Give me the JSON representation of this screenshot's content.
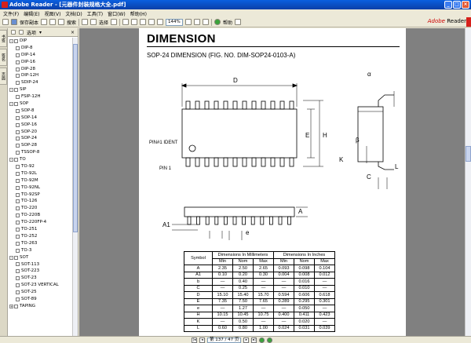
{
  "window": {
    "title": "Adobe Reader - [元器件封装规格大全.pdf]",
    "controls": [
      "_",
      "□",
      "×"
    ]
  },
  "menu": [
    "文件(F)",
    "编辑(E)",
    "视图(V)",
    "文档(D)",
    "工具(T)",
    "窗口(W)",
    "帮助(H)"
  ],
  "toolbar": {
    "save_copy": "保存副本",
    "search": "搜索",
    "select": "选择",
    "zoom": "144%",
    "help": "帮助",
    "brand_adobe": "Adobe",
    "brand_reader": "Reader"
  },
  "navtabs": [
    "书签",
    "签名",
    "页面"
  ],
  "panel": {
    "options": "选项",
    "bookmarks": [
      {
        "level": 0,
        "toggle": "-",
        "label": "DIP"
      },
      {
        "level": 1,
        "label": "DIP-8"
      },
      {
        "level": 1,
        "label": "DIP-14"
      },
      {
        "level": 1,
        "label": "DIP-16"
      },
      {
        "level": 1,
        "label": "DIP-28"
      },
      {
        "level": 1,
        "label": "DIP-12H"
      },
      {
        "level": 1,
        "label": "SDIP-24"
      },
      {
        "level": 0,
        "toggle": "-",
        "label": "SIP"
      },
      {
        "level": 1,
        "label": "FSIP-12H"
      },
      {
        "level": 0,
        "toggle": "-",
        "label": "SOP"
      },
      {
        "level": 1,
        "label": "SOP-8"
      },
      {
        "level": 1,
        "label": "SOP-14"
      },
      {
        "level": 1,
        "label": "SOP-16"
      },
      {
        "level": 1,
        "label": "SOP-20"
      },
      {
        "level": 1,
        "label": "SOP-24"
      },
      {
        "level": 1,
        "label": "SOP-28"
      },
      {
        "level": 1,
        "label": "TSSOP-8"
      },
      {
        "level": 0,
        "toggle": "-",
        "label": "TO"
      },
      {
        "level": 1,
        "label": "TO-92"
      },
      {
        "level": 1,
        "label": "TO-92L"
      },
      {
        "level": 1,
        "label": "TO-92M"
      },
      {
        "level": 1,
        "label": "TO-92NL"
      },
      {
        "level": 1,
        "label": "TO-92SP"
      },
      {
        "level": 1,
        "label": "TO-126"
      },
      {
        "level": 1,
        "label": "TO-220"
      },
      {
        "level": 1,
        "label": "TO-220B"
      },
      {
        "level": 1,
        "label": "TO-220FP-4"
      },
      {
        "level": 1,
        "label": "TO-251"
      },
      {
        "level": 1,
        "label": "TO-252"
      },
      {
        "level": 1,
        "label": "TO-263"
      },
      {
        "level": 1,
        "label": "TO-3"
      },
      {
        "level": 0,
        "toggle": "-",
        "label": "SOT"
      },
      {
        "level": 1,
        "label": "SOT-113"
      },
      {
        "level": 1,
        "label": "SOT-223"
      },
      {
        "level": 1,
        "label": "SOT-23"
      },
      {
        "level": 1,
        "label": "SOT-23 VERTICAL"
      },
      {
        "level": 1,
        "label": "SOT-25"
      },
      {
        "level": 1,
        "label": "SOT-89"
      },
      {
        "level": 0,
        "toggle": "+",
        "label": "TAPING"
      }
    ]
  },
  "document": {
    "heading": "DIMENSION",
    "subtitle": "SOP-24 DIMENSION (FIG. NO. DIM-SOP24-0103-A)",
    "labels": {
      "D": "D",
      "E": "E",
      "H": "H",
      "A": "A",
      "A1": "A1",
      "e": "e",
      "L": "L",
      "K": "K",
      "C": "C",
      "alpha": "α",
      "beta": "β",
      "pin1_ident": "PIN#1 IDENT",
      "pin1": "PIN 1"
    },
    "table": {
      "symbol_header": "Symbol",
      "mm_header": "Dimensions In Millimeters",
      "in_header": "Dimensions In Inches",
      "sub_headers": [
        "Min",
        "Nom",
        "Max",
        "Min",
        "Nom",
        "Max"
      ],
      "rows": [
        [
          "A",
          "2.35",
          "2.50",
          "2.65",
          "0.093",
          "0.098",
          "0.104"
        ],
        [
          "A1",
          "0.10",
          "0.20",
          "0.30",
          "0.004",
          "0.008",
          "0.012"
        ],
        [
          "b",
          "—",
          "0.40",
          "—",
          "—",
          "0.016",
          "—"
        ],
        [
          "C",
          "—",
          "0.25",
          "—",
          "—",
          "0.010",
          "—"
        ],
        [
          "D",
          "15.10",
          "15.40",
          "15.70",
          "0.594",
          "0.606",
          "0.618"
        ],
        [
          "E",
          "7.35",
          "7.50",
          "7.65",
          "0.289",
          "0.295",
          "0.301"
        ],
        [
          "e",
          "—",
          "1.27",
          "—",
          "—",
          "0.050",
          "—"
        ],
        [
          "H",
          "10.15",
          "10.45",
          "10.75",
          "0.400",
          "0.411",
          "0.423"
        ],
        [
          "K",
          "—",
          "0.50",
          "—",
          "—",
          "0.020",
          "—"
        ],
        [
          "L",
          "0.60",
          "0.80",
          "1.00",
          "0.024",
          "0.031",
          "0.039"
        ]
      ]
    }
  },
  "status": {
    "page_label": "第 137 / 47 页"
  }
}
